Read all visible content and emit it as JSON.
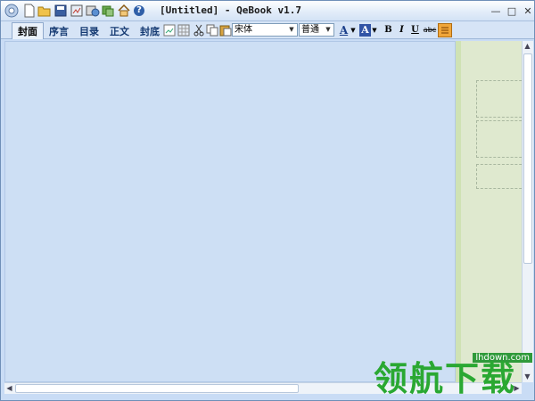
{
  "window": {
    "title": "[Untitled] - QeBook v1.7",
    "minimize_glyph": "—",
    "maximize_glyph": "□",
    "close_glyph": "✕"
  },
  "quickbar": {
    "icons": [
      "app-menu-icon",
      "new-file-icon",
      "open-folder-icon",
      "save-icon",
      "preview-icon",
      "compile-icon",
      "export-icon",
      "home-icon",
      "help-icon"
    ],
    "help_glyph": "?"
  },
  "tabs": [
    {
      "label": "封面",
      "active": true
    },
    {
      "label": "序言",
      "active": false
    },
    {
      "label": "目录",
      "active": false
    },
    {
      "label": "正文",
      "active": false
    },
    {
      "label": "封底",
      "active": false
    }
  ],
  "toolbar": {
    "font_family": "宋体",
    "font_size": "普通",
    "bold": "B",
    "italic": "I",
    "underline": "U",
    "strike": "abc",
    "font_color_glyph": "A",
    "highlight_glyph": "A"
  },
  "colors": {
    "accent": "#2f5fa8",
    "editor_bg": "#cddff4",
    "preview_bg": "#dfe9cf",
    "watermark": "#2aa832"
  },
  "watermark": {
    "site": "lhdown.com",
    "text": "领航下载"
  }
}
